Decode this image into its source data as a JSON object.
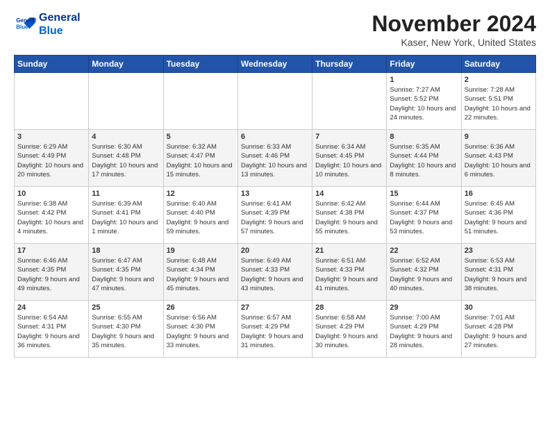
{
  "header": {
    "logo_line1": "General",
    "logo_line2": "Blue",
    "month": "November 2024",
    "location": "Kaser, New York, United States"
  },
  "days_of_week": [
    "Sunday",
    "Monday",
    "Tuesday",
    "Wednesday",
    "Thursday",
    "Friday",
    "Saturday"
  ],
  "weeks": [
    [
      {
        "day": "",
        "info": ""
      },
      {
        "day": "",
        "info": ""
      },
      {
        "day": "",
        "info": ""
      },
      {
        "day": "",
        "info": ""
      },
      {
        "day": "",
        "info": ""
      },
      {
        "day": "1",
        "info": "Sunrise: 7:27 AM\nSunset: 5:52 PM\nDaylight: 10 hours and 24 minutes."
      },
      {
        "day": "2",
        "info": "Sunrise: 7:28 AM\nSunset: 5:51 PM\nDaylight: 10 hours and 22 minutes."
      }
    ],
    [
      {
        "day": "3",
        "info": "Sunrise: 6:29 AM\nSunset: 4:49 PM\nDaylight: 10 hours and 20 minutes."
      },
      {
        "day": "4",
        "info": "Sunrise: 6:30 AM\nSunset: 4:48 PM\nDaylight: 10 hours and 17 minutes."
      },
      {
        "day": "5",
        "info": "Sunrise: 6:32 AM\nSunset: 4:47 PM\nDaylight: 10 hours and 15 minutes."
      },
      {
        "day": "6",
        "info": "Sunrise: 6:33 AM\nSunset: 4:46 PM\nDaylight: 10 hours and 13 minutes."
      },
      {
        "day": "7",
        "info": "Sunrise: 6:34 AM\nSunset: 4:45 PM\nDaylight: 10 hours and 10 minutes."
      },
      {
        "day": "8",
        "info": "Sunrise: 6:35 AM\nSunset: 4:44 PM\nDaylight: 10 hours and 8 minutes."
      },
      {
        "day": "9",
        "info": "Sunrise: 6:36 AM\nSunset: 4:43 PM\nDaylight: 10 hours and 6 minutes."
      }
    ],
    [
      {
        "day": "10",
        "info": "Sunrise: 6:38 AM\nSunset: 4:42 PM\nDaylight: 10 hours and 4 minutes."
      },
      {
        "day": "11",
        "info": "Sunrise: 6:39 AM\nSunset: 4:41 PM\nDaylight: 10 hours and 1 minute."
      },
      {
        "day": "12",
        "info": "Sunrise: 6:40 AM\nSunset: 4:40 PM\nDaylight: 9 hours and 59 minutes."
      },
      {
        "day": "13",
        "info": "Sunrise: 6:41 AM\nSunset: 4:39 PM\nDaylight: 9 hours and 57 minutes."
      },
      {
        "day": "14",
        "info": "Sunrise: 6:42 AM\nSunset: 4:38 PM\nDaylight: 9 hours and 55 minutes."
      },
      {
        "day": "15",
        "info": "Sunrise: 6:44 AM\nSunset: 4:37 PM\nDaylight: 9 hours and 53 minutes."
      },
      {
        "day": "16",
        "info": "Sunrise: 6:45 AM\nSunset: 4:36 PM\nDaylight: 9 hours and 51 minutes."
      }
    ],
    [
      {
        "day": "17",
        "info": "Sunrise: 6:46 AM\nSunset: 4:35 PM\nDaylight: 9 hours and 49 minutes."
      },
      {
        "day": "18",
        "info": "Sunrise: 6:47 AM\nSunset: 4:35 PM\nDaylight: 9 hours and 47 minutes."
      },
      {
        "day": "19",
        "info": "Sunrise: 6:48 AM\nSunset: 4:34 PM\nDaylight: 9 hours and 45 minutes."
      },
      {
        "day": "20",
        "info": "Sunrise: 6:49 AM\nSunset: 4:33 PM\nDaylight: 9 hours and 43 minutes."
      },
      {
        "day": "21",
        "info": "Sunrise: 6:51 AM\nSunset: 4:33 PM\nDaylight: 9 hours and 41 minutes."
      },
      {
        "day": "22",
        "info": "Sunrise: 6:52 AM\nSunset: 4:32 PM\nDaylight: 9 hours and 40 minutes."
      },
      {
        "day": "23",
        "info": "Sunrise: 6:53 AM\nSunset: 4:31 PM\nDaylight: 9 hours and 38 minutes."
      }
    ],
    [
      {
        "day": "24",
        "info": "Sunrise: 6:54 AM\nSunset: 4:31 PM\nDaylight: 9 hours and 36 minutes."
      },
      {
        "day": "25",
        "info": "Sunrise: 6:55 AM\nSunset: 4:30 PM\nDaylight: 9 hours and 35 minutes."
      },
      {
        "day": "26",
        "info": "Sunrise: 6:56 AM\nSunset: 4:30 PM\nDaylight: 9 hours and 33 minutes."
      },
      {
        "day": "27",
        "info": "Sunrise: 6:57 AM\nSunset: 4:29 PM\nDaylight: 9 hours and 31 minutes."
      },
      {
        "day": "28",
        "info": "Sunrise: 6:58 AM\nSunset: 4:29 PM\nDaylight: 9 hours and 30 minutes."
      },
      {
        "day": "29",
        "info": "Sunrise: 7:00 AM\nSunset: 4:29 PM\nDaylight: 9 hours and 28 minutes."
      },
      {
        "day": "30",
        "info": "Sunrise: 7:01 AM\nSunset: 4:28 PM\nDaylight: 9 hours and 27 minutes."
      }
    ]
  ]
}
